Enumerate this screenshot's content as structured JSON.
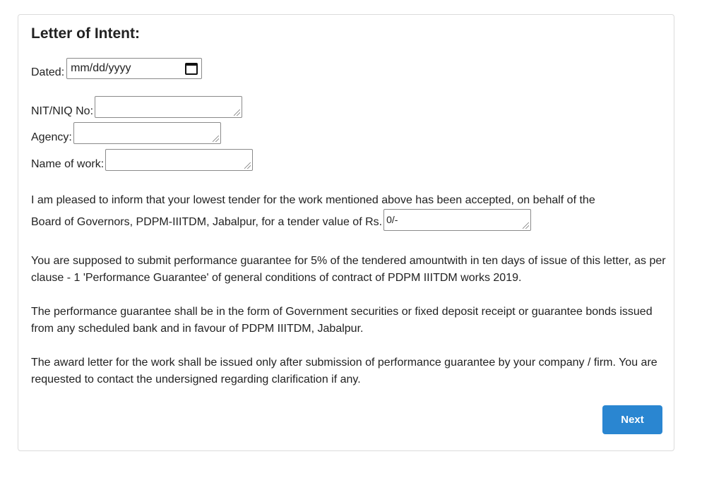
{
  "form": {
    "title": "Letter of Intent:",
    "dated_label": "Dated:",
    "dated_placeholder": "mm/dd/yyyy",
    "nit_label": "NIT/NIQ No:",
    "nit_value": "",
    "agency_label": "Agency:",
    "agency_value": "",
    "work_label": "Name of work:",
    "work_value": "",
    "tender_line1": "I am pleased to inform that your lowest tender for the work mentioned above has been accepted, on behalf of the",
    "tender_line2": "Board of Governors, PDPM-IIITDM, Jabalpur, for a tender value of Rs.",
    "tender_value": "0/-",
    "para_guarantee": "You are supposed to submit performance guarantee for 5% of the tendered amountwith in ten days of issue of this letter, as per clause - 1 'Performance Guarantee' of general conditions of contract of PDPM IIITDM works 2019.",
    "para_form": "The performance guarantee shall be in the form of Government securities or fixed deposit receipt or guarantee bonds issued from any scheduled bank and in favour of PDPM IIITDM, Jabalpur.",
    "para_award": "The award letter for the work shall be issued only after submission of performance guarantee by your company / firm. You are requested to contact the undersigned regarding clarification if any.",
    "next_label": "Next"
  },
  "colors": {
    "accent": "#2a86d1",
    "border": "#dcdcdc"
  },
  "icons": {
    "date_picker": "calendar-icon",
    "resize": "resize-grip-icon"
  }
}
